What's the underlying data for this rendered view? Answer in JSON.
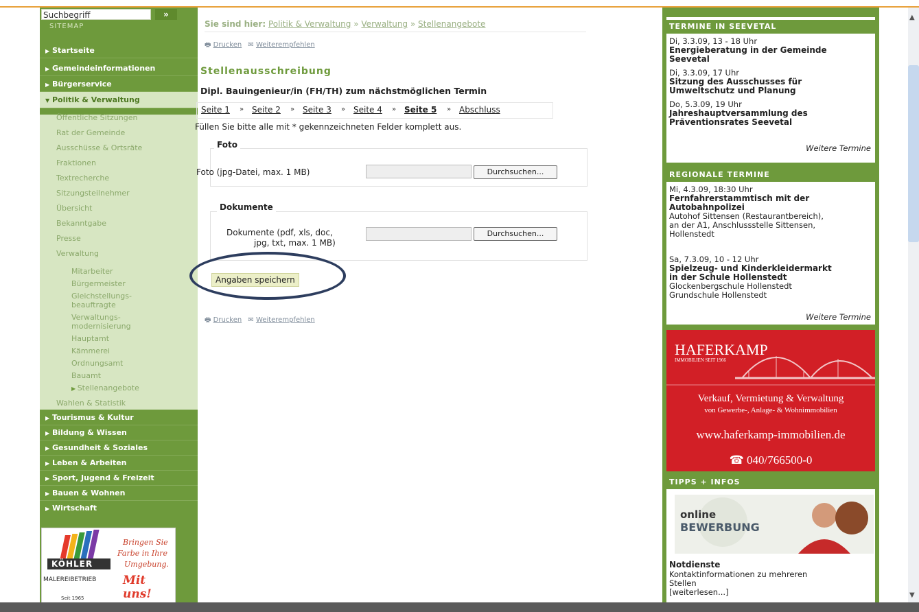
{
  "sidebar": {
    "search_placeholder": "Suchbegriff",
    "search_go": "»",
    "sitemap": "SITEMAP",
    "top_items": [
      {
        "label": "Startseite"
      },
      {
        "label": "Gemeindeinformationen"
      },
      {
        "label": "Bürgerservice"
      },
      {
        "label": "Politik & Verwaltung"
      }
    ],
    "sub_items": [
      "Öffentliche Sitzungen",
      "Rat der Gemeinde",
      "Ausschüsse & Ortsräte",
      "Fraktionen",
      "Textrecherche",
      "Sitzungsteilnehmer",
      "Übersicht",
      "Bekanntgabe",
      "Presse",
      "Verwaltung"
    ],
    "verwaltung_items": [
      "Mitarbeiter",
      "Bürgermeister",
      "Gleichstellungs-",
      "beauftragte",
      "Verwaltungs-",
      "modernisierung",
      "Hauptamt",
      "Kämmerei",
      "Ordnungsamt",
      "Bauamt",
      "Stellenangebote"
    ],
    "wahlen": "Wahlen & Statistik",
    "bottom_items": [
      "Tourismus & Kultur",
      "Bildung & Wissen",
      "Gesundheit & Soziales",
      "Leben & Arbeiten",
      "Sport, Jugend & Freizeit",
      "Bauen & Wohnen",
      "Wirtschaft"
    ],
    "promo": {
      "logo": "KÖHLER",
      "slogan1": "Bringen Sie",
      "slogan2": "Farbe in Ihre",
      "slogan3": "Umgebung.",
      "cta": "Mit uns!",
      "company": "MALEREIBETRIEB",
      "since": "Seit 1965"
    }
  },
  "breadcrumb": {
    "prefix": "Sie sind hier:",
    "items": [
      "Politik & Verwaltung",
      "Verwaltung",
      "Stellenangebote"
    ],
    "sep": "»"
  },
  "tools": {
    "print": "Drucken",
    "recommend": "Weiterempfehlen"
  },
  "main": {
    "title": "Stellenausschreibung",
    "subtitle": "Dipl. Bauingenieur/in (FH/TH) zum nächstmöglichen Termin",
    "steps": [
      "Seite 1",
      "Seite 2",
      "Seite 3",
      "Seite 4",
      "Seite 5",
      "Abschluss"
    ],
    "hint": "Füllen Sie bitte alle mit * gekennzeichneten Felder komplett aus.",
    "foto_legend": "Foto",
    "foto_label": "Foto (jpg-Datei, max. 1 MB)",
    "browse": "Durchsuchen...",
    "doc_legend": "Dokumente",
    "doc_label1": "Dokumente (pdf, xls, doc,",
    "doc_label2": "jpg, txt, max. 1 MB)",
    "save": "Angaben speichern"
  },
  "right": {
    "termine_head": "TERMINE IN SEEVETAL",
    "termine": [
      {
        "date": "Di, 3.3.09, 13 - 18 Uhr",
        "title1": "Energieberatung in der Gemeinde",
        "title2": "Seevetal"
      },
      {
        "date": "Di, 3.3.09, 17 Uhr",
        "title1": "Sitzung des Ausschusses für",
        "title2": "Umweltschutz und Planung"
      },
      {
        "date": "Do, 5.3.09, 19 Uhr",
        "title1": "Jahreshauptversammlung des",
        "title2": "Präventionsrates Seevetal"
      }
    ],
    "more": "Weitere Termine",
    "regional_head": "REGIONALE TERMINE",
    "regional": [
      {
        "date": "Mi, 4.3.09, 18:30 Uhr",
        "title1": "Fernfahrerstammtisch mit der",
        "title2": "Autobahnpolizei",
        "text1": "Autohof Sittensen (Restaurantbereich),",
        "text2": "an der A1, Anschlussstelle Sittensen,",
        "text3": "Hollenstedt"
      },
      {
        "date": "Sa, 7.3.09, 10 - 12 Uhr",
        "title1": "Spielzeug- und Kinderkleidermarkt",
        "title2": "in der Schule Hollenstedt",
        "text1": "Glockenbergschule Hollenstedt",
        "text2": "Grundschule Hollenstedt",
        "text3": ""
      }
    ],
    "ad": {
      "brand": "HAFERKAMP",
      "since": "IMMOBILIEN SEIT 1966",
      "line1": "Verkauf, Vermietung & Verwaltung",
      "line2": "von Gewerbe-, Anlage- & Wohnimmobilien",
      "url": "www.haferkamp-immobilien.de",
      "phone": "☎ 040/766500-0"
    },
    "tipps_head": "TIPPS + INFOS",
    "online1": "online",
    "online2": "BEWERBUNG",
    "notdienste_title": "Notdienste",
    "notdienste_text1": "Kontaktinformationen zu mehreren",
    "notdienste_text2": "Stellen",
    "notdienste_more": "[weiterlesen...]"
  },
  "colors": {
    "green": "#6e9a3c",
    "light_green": "#d7e6c2",
    "ad_red": "#d21f26",
    "circle": "#2d3d5e"
  }
}
